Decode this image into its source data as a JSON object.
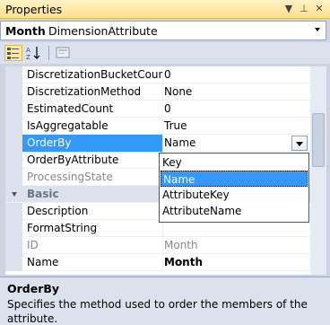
{
  "window": {
    "title": "Properties"
  },
  "titlebar_buttons": {
    "dropdown": "▼",
    "pin": "⊥",
    "close": "✕"
  },
  "object_selector": {
    "name": "Month",
    "type": "DimensionAttribute"
  },
  "toolbar": {
    "categorized": "categorized-icon",
    "alphabetical": "alphabetical-icon",
    "property_pages": "property-pages-icon"
  },
  "grid": {
    "rows": [
      {
        "name": "DiscretizationBucketCoun",
        "value": "0"
      },
      {
        "name": "DiscretizationMethod",
        "value": "None"
      },
      {
        "name": "EstimatedCount",
        "value": "0"
      },
      {
        "name": "IsAggregatable",
        "value": "True"
      },
      {
        "name": "OrderBy",
        "value": "Name"
      },
      {
        "name": "OrderByAttribute",
        "value": ""
      },
      {
        "name": "ProcessingState",
        "value": ""
      },
      {
        "name": "Basic",
        "value": ""
      },
      {
        "name": "Description",
        "value": ""
      },
      {
        "name": "FormatString",
        "value": ""
      },
      {
        "name": "ID",
        "value": "Month"
      },
      {
        "name": "Name",
        "value": "Month"
      }
    ]
  },
  "dropdown_options": [
    "Key",
    "Name",
    "AttributeKey",
    "AttributeName"
  ],
  "description": {
    "title": "OrderBy",
    "text": "Specifies the method used to order the members of the attribute."
  },
  "colors": {
    "selection": "#3399ff",
    "titlebar": "#ffe08a",
    "panel": "#dbe2ee"
  }
}
